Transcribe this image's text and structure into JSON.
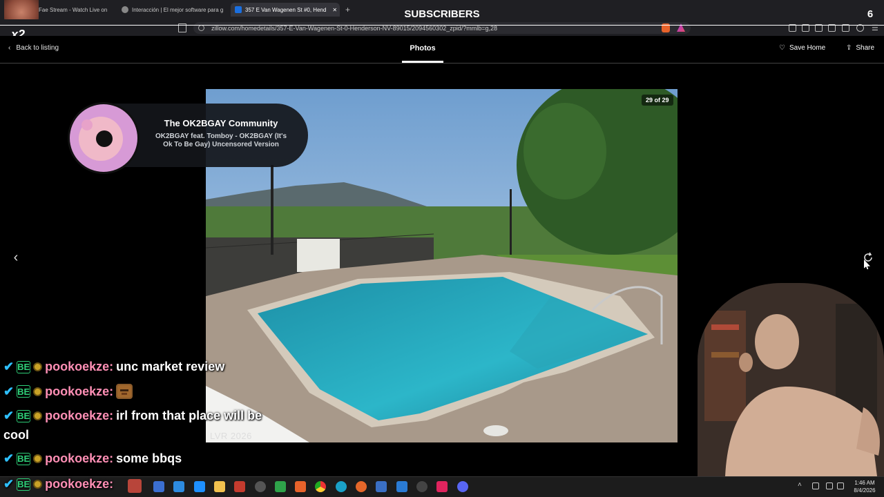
{
  "browser": {
    "tabs": [
      {
        "label": "Fae Stream - Watch Live on",
        "active": false
      },
      {
        "label": "Interacción | El mejor software para g",
        "active": false
      },
      {
        "label": "357 E Van Wagenen St #0, Hend",
        "active": true
      }
    ],
    "new_tab_symbol": "+",
    "url": "zillow.com/homedetails/357-E-Van-Wagenen-St-0-Henderson-NV-89015/2094560302_zpid/?mmlb=g,28"
  },
  "page": {
    "back_label": "Back to listing",
    "tab_photos": "Photos",
    "save_home": "Save Home",
    "share": "Share",
    "photo_counter": "29 of 29",
    "photo_watermark": "LVR 2026"
  },
  "overlay": {
    "subscribers_label": "SUBSCRIBERS",
    "subscribers_count": "6",
    "multiplier": "x2"
  },
  "now_playing": {
    "title": "The OK2BGAY Community",
    "song": "OK2BGAY feat. Tomboy - OK2BGAY (It's Ok To Be Gay) Uncensored Version"
  },
  "chat": {
    "badge_text": "BE",
    "messages": [
      {
        "user": "pookoekze:",
        "text": "unc market review"
      },
      {
        "user": "pookoekze:",
        "text": ""
      },
      {
        "user": "pookoekze:",
        "text": "irl from that place will be"
      },
      {
        "user": "pookoekze:",
        "text": "some bbqs"
      },
      {
        "user": "pookoekze:",
        "text": ""
      }
    ],
    "continuation": "cool"
  },
  "taskbar": {
    "clock_time": "1:46 AM",
    "clock_date": "8/4/2026"
  },
  "colors": {
    "accent_chat_name": "#ff8fb5",
    "badge_green": "#2fd27a",
    "badge_blue": "#2ec0ff"
  }
}
